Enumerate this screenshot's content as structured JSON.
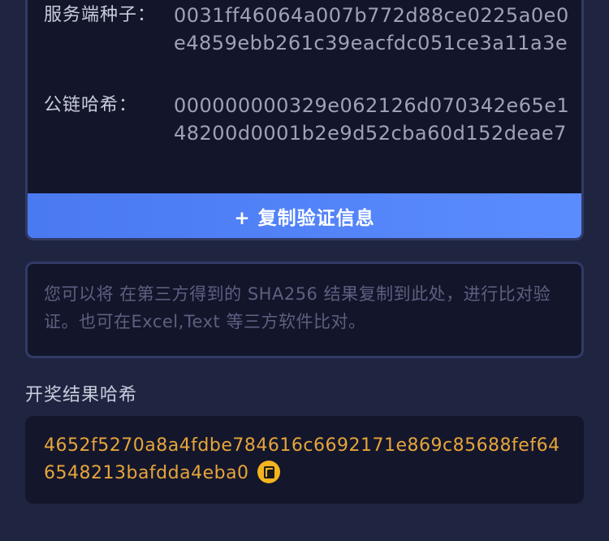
{
  "verify": {
    "server_seed_label": "服务端种子：",
    "server_seed_value": "0031ff46064a007b772d88ce0225a0e0e4859ebb261c39eacfdc051ce3a11a3e",
    "chain_hash_label": "公链哈希：",
    "chain_hash_value": "000000000329e062126d070342e65e148200d0001b2e9d52cba60d152deae7",
    "copy_button_label": "+ 复制验证信息"
  },
  "compare": {
    "placeholder": "您可以将 在第三方得到的 SHA256 结果复制到此处，进行比对验证。也可在Excel,Text 等三方软件比对。"
  },
  "result": {
    "title": "开奖结果哈希",
    "hash_value": "4652f5270a8a4fdbe784616c6692171e869c85688fef646548213bafdda4eba0",
    "copy_icon": "copy-icon",
    "accent_color": "#e6a53a"
  }
}
